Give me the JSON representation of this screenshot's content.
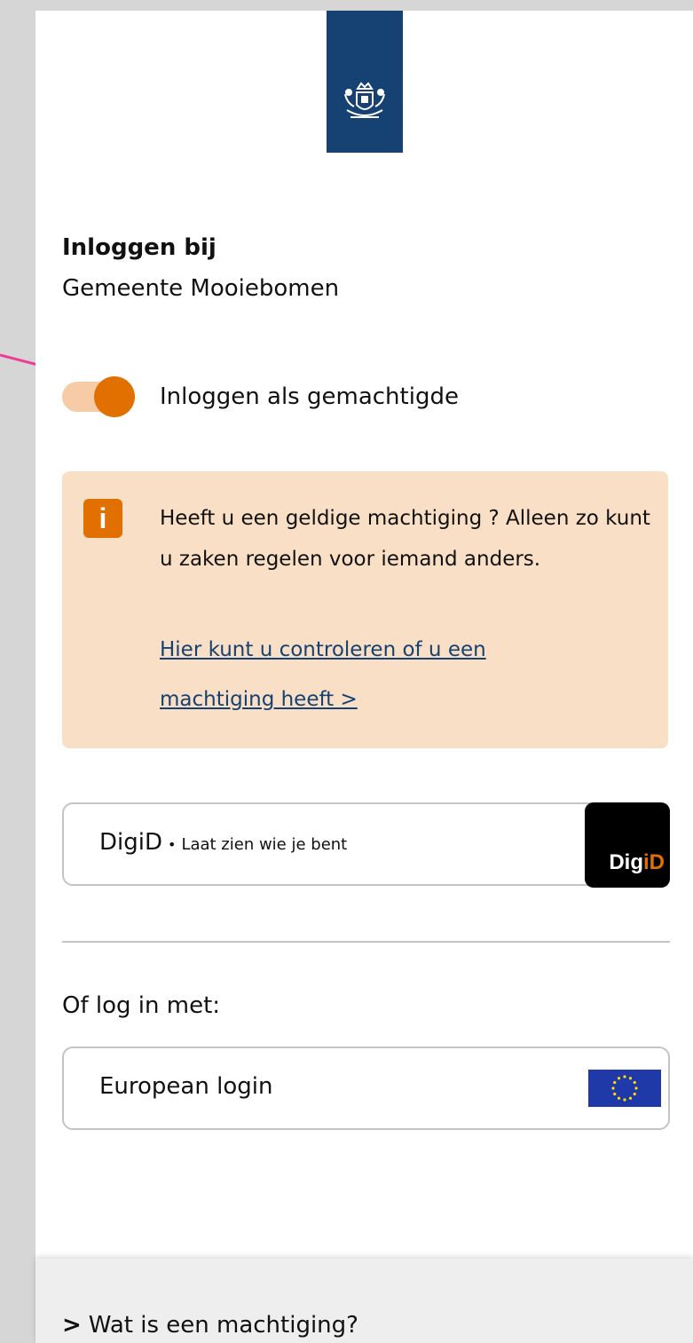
{
  "logo": {
    "icon": "coat-of-arms-icon",
    "color": "#154273"
  },
  "login": {
    "heading": "Inloggen bij",
    "organization": "Gemeente Mooiebomen"
  },
  "toggle": {
    "label": "Inloggen als gemachtigde",
    "state": "on",
    "color": "#e17000"
  },
  "notice": {
    "icon_text": "i",
    "text": "Heeft u een geldige machtiging ? Alleen zo kunt u zaken regelen voor iemand anders.",
    "link": "Hier kunt u controleren of u een machtiging heeft >",
    "background": "#f9dfc5"
  },
  "digid": {
    "name": "DigiD",
    "separator": "•",
    "description": "Laat zien wie je bent",
    "logo_text_main": "Dig",
    "logo_text_accent": "iD"
  },
  "alternatives": {
    "label": "Of log in met:",
    "european_login": "European login",
    "flag_icon": "eu-flag-icon"
  },
  "faq": {
    "chevron": ">",
    "item": "Wat is een machtiging?"
  },
  "annotation": {
    "icon": "pink-arrow-icon",
    "color": "#ee3d96"
  }
}
